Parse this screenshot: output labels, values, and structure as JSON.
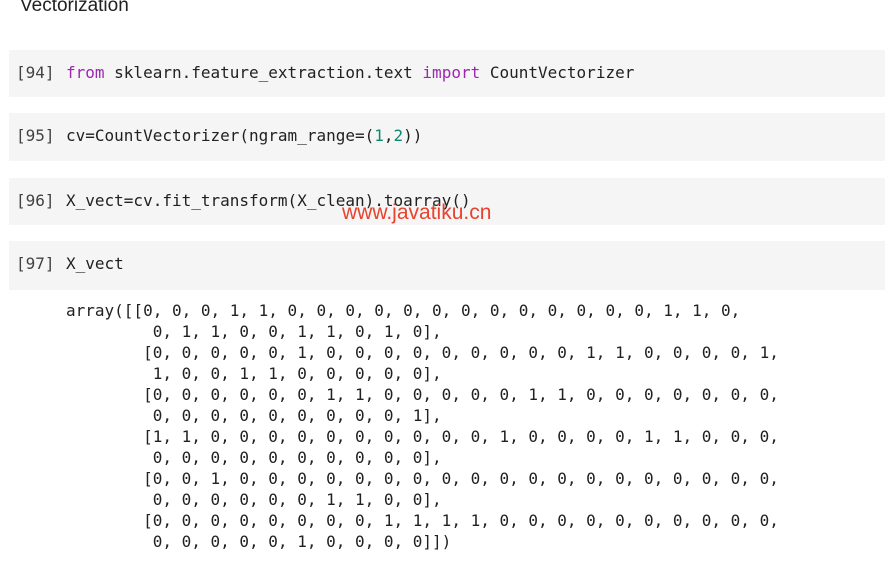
{
  "section": {
    "heading": "Vectorization"
  },
  "cells": [
    {
      "prompt": "[94]",
      "kw_from": "from",
      "module": " sklearn.feature_extraction.text ",
      "kw_import": "import",
      "name": " CountVectorizer"
    },
    {
      "prompt": "[95]",
      "code_a": "cv=CountVectorizer(ngram_range=(",
      "num1": "1",
      "comma": ",",
      "num2": "2",
      "code_b": "))"
    },
    {
      "prompt": "[96]",
      "code": "X_vect=cv.fit_transform(X_clean).toarray()"
    },
    {
      "prompt": "[97]",
      "code": "X_vect",
      "output": [
        "array([[0, 0, 0, 1, 1, 0, 0, 0, 0, 0, 0, 0, 0, 0, 0, 0, 0, 0, 1, 1, 0,",
        "         0, 1, 1, 0, 0, 1, 1, 0, 1, 0],",
        "        [0, 0, 0, 0, 0, 1, 0, 0, 0, 0, 0, 0, 0, 0, 0, 1, 1, 0, 0, 0, 0, 1,",
        "         1, 0, 0, 1, 1, 0, 0, 0, 0, 0],",
        "        [0, 0, 0, 0, 0, 0, 1, 1, 0, 0, 0, 0, 0, 1, 1, 0, 0, 0, 0, 0, 0, 0,",
        "         0, 0, 0, 0, 0, 0, 0, 0, 0, 1],",
        "        [1, 1, 0, 0, 0, 0, 0, 0, 0, 0, 0, 0, 1, 0, 0, 0, 0, 1, 1, 0, 0, 0,",
        "         0, 0, 0, 0, 0, 0, 0, 0, 0, 0],",
        "        [0, 0, 1, 0, 0, 0, 0, 0, 0, 0, 0, 0, 0, 0, 0, 0, 0, 0, 0, 0, 0, 0,",
        "         0, 0, 0, 0, 0, 0, 1, 1, 0, 0],",
        "        [0, 0, 0, 0, 0, 0, 0, 0, 1, 1, 1, 1, 0, 0, 0, 0, 0, 0, 0, 0, 0, 0,",
        "         0, 0, 0, 0, 0, 1, 0, 0, 0, 0]])"
      ]
    }
  ],
  "watermark": {
    "text": "www.javatiku.cn"
  },
  "colors": {
    "keyword": "#9c27b0",
    "number": "#0b8a6f",
    "watermark": "#e8432e",
    "cell_bg": "#f5f5f5"
  }
}
